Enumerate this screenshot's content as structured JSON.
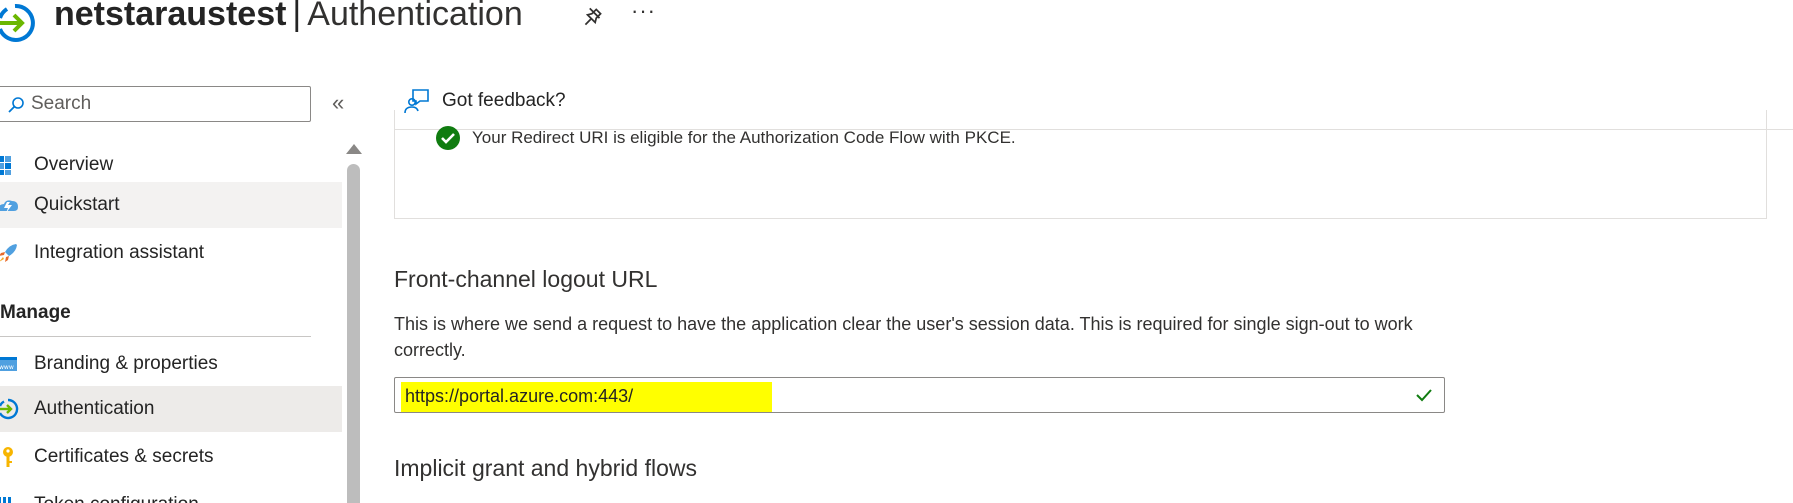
{
  "header": {
    "app_name": "netstaraustest",
    "separator": "|",
    "section": "Authentication",
    "more_label": "···",
    "icon": "authentication-icon",
    "pin_icon": "pin-icon"
  },
  "sidebar": {
    "search_placeholder": "Search",
    "collapse_label": "«",
    "items": [
      {
        "label": "Overview",
        "icon": "overview-grid-icon"
      },
      {
        "label": "Quickstart",
        "icon": "quickstart-cloud-icon"
      },
      {
        "label": "Integration assistant",
        "icon": "rocket-icon"
      }
    ],
    "manage_header": "Manage",
    "manage_items": [
      {
        "label": "Branding & properties",
        "icon": "branding-www-icon"
      },
      {
        "label": "Authentication",
        "icon": "authentication-icon"
      },
      {
        "label": "Certificates & secrets",
        "icon": "key-icon"
      },
      {
        "label": "Token configuration",
        "icon": "bars-icon"
      }
    ]
  },
  "toolbar": {
    "feedback_label": "Got feedback?",
    "feedback_icon": "feedback-person-icon"
  },
  "main": {
    "pkce_message": "Your Redirect URI is eligible for the Authorization Code Flow with PKCE.",
    "front_channel_heading": "Front-channel logout URL",
    "front_channel_desc": "This is where we send a request to have the application clear the user's session data. This is required for single sign-out to work correctly.",
    "logout_url_value": "https://portal.azure.com:443/",
    "implicit_heading": "Implicit grant and hybrid flows"
  },
  "colors": {
    "accent": "#0078d4",
    "success": "#107c10",
    "highlight": "#ffff00",
    "selected_bg": "#edebe9"
  }
}
